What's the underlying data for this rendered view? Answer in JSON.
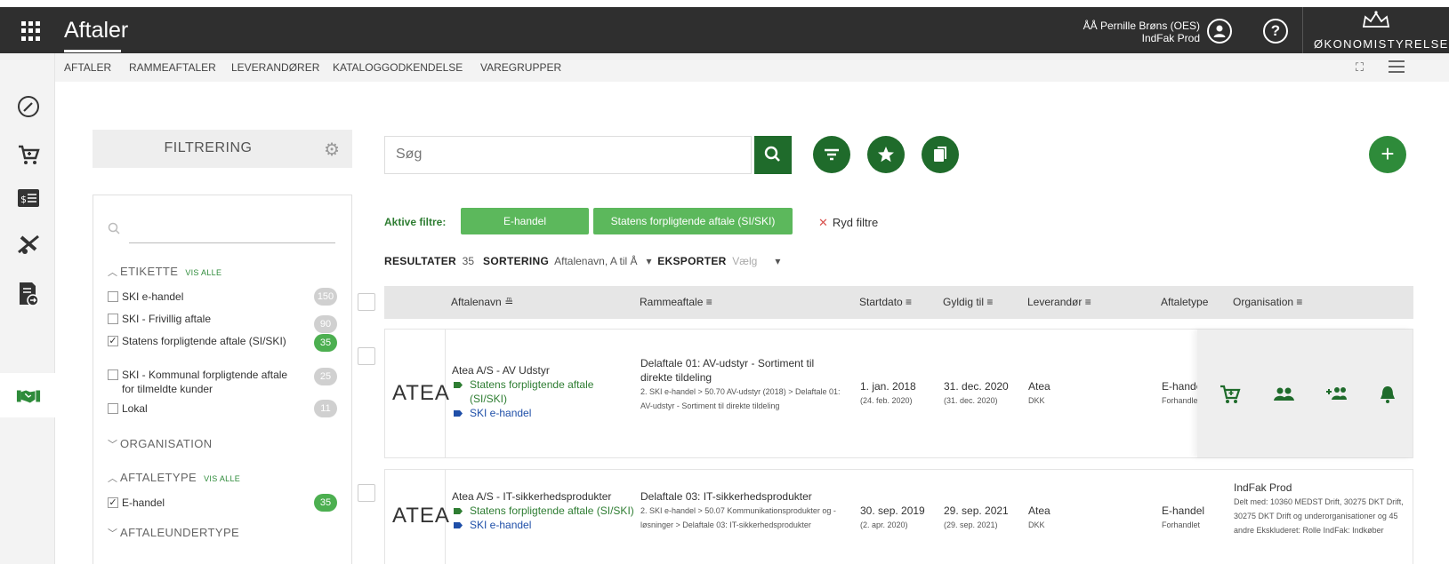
{
  "app": {
    "title": "Aftaler",
    "user_name": "ÅÅ Pernille Brøns (OES)",
    "environment": "IndFak Prod",
    "logo_text": "ØKONOMISTYRELSEN"
  },
  "nav": {
    "tabs": [
      "AFTALER",
      "RAMMEAFTALER",
      "LEVERANDØRER",
      "KATALOGGODKENDELSE",
      "VAREGRUPPER"
    ]
  },
  "filter": {
    "title": "FILTRERING",
    "sections": {
      "etikette": {
        "label": "ETIKETTE",
        "vis_alle": "VIS ALLE"
      },
      "organisation": {
        "label": "ORGANISATION"
      },
      "aftaletype": {
        "label": "AFTALETYPE",
        "vis_alle": "VIS ALLE"
      },
      "aftaleundertype": {
        "label": "AFTALEUNDERTYPE"
      }
    },
    "etikette_options": [
      {
        "label": "SKI e-handel",
        "count": "150",
        "checked": false
      },
      {
        "label": "SKI - Frivillig aftale",
        "count": "90",
        "checked": false
      },
      {
        "label": "Statens forpligtende aftale (SI/SKI)",
        "count": "35",
        "checked": true
      },
      {
        "label": "SKI - Kommunal forpligtende aftale for tilmeldte kunder",
        "count": "25",
        "checked": false
      },
      {
        "label": "Lokal",
        "count": "11",
        "checked": false
      }
    ],
    "aftaletype_options": [
      {
        "label": "E-handel",
        "count": "35",
        "checked": true
      }
    ]
  },
  "search": {
    "placeholder": "Søg"
  },
  "active_filters": {
    "label": "Aktive filtre:",
    "chips": [
      "E-handel",
      "Statens forpligtende aftale (SI/SKI)"
    ],
    "clear_label": "Ryd filtre"
  },
  "results": {
    "label": "RESULTATER",
    "count": "35",
    "sort_label": "SORTERING",
    "sort_value": "Aftalenavn, A til Å",
    "export_label": "EKSPORTER",
    "export_value": "Vælg"
  },
  "table": {
    "headers": {
      "name": "Aftalenavn",
      "framework": "Rammeaftale",
      "start": "Startdato",
      "valid": "Gyldig til",
      "supplier": "Leverandør",
      "type": "Aftaletype",
      "org": "Organisation"
    },
    "rows": [
      {
        "logo": "ATEA",
        "name": "Atea A/S - AV Udstyr",
        "tags": [
          "Statens forpligtende aftale (SI/SKI)",
          "SKI e-handel"
        ],
        "framework_title": "Delaftale 01: AV-udstyr - Sortiment til direkte tildeling",
        "framework_path": "2. SKI e-handel > 50.70 AV-udstyr (2018) > Delaftale 01: AV-udstyr - Sortiment til direkte tildeling",
        "start": "1. jan. 2018",
        "start_sub": "(24. feb. 2020)",
        "valid": "31. dec. 2020",
        "valid_sub": "(31. dec. 2020)",
        "supplier": "Atea",
        "supplier_sub": "DKK",
        "type": "E-handel",
        "type_sub": "Forhandlet"
      },
      {
        "logo": "ATEA",
        "name": "Atea A/S - IT-sikkerhedsprodukter",
        "tags": [
          "Statens forpligtende aftale (SI/SKI)",
          "SKI e-handel"
        ],
        "framework_title": "Delaftale 03: IT-sikkerhedsprodukter",
        "framework_path": "2. SKI e-handel > 50.07 Kommunikationsprodukter og -løsninger > Delaftale 03: IT-sikkerhedsprodukter",
        "start": "30. sep. 2019",
        "start_sub": "(2. apr. 2020)",
        "valid": "29. sep. 2021",
        "valid_sub": "(29. sep. 2021)",
        "supplier": "Atea",
        "supplier_sub": "DKK",
        "type": "E-handel",
        "type_sub": "Forhandlet",
        "org_title": "IndFak Prod",
        "org_detail": "Delt med: 10360 MEDST Drift, 30275 DKT Drift, 30275 DKT Drift og underorganisationer og 45 andre Ekskluderet: Rolle IndFak: Indkøber"
      }
    ]
  },
  "colors": {
    "dark_green": "#1f6b2b",
    "chip_green": "#5cb85c",
    "topbar": "#2f2f2f"
  }
}
